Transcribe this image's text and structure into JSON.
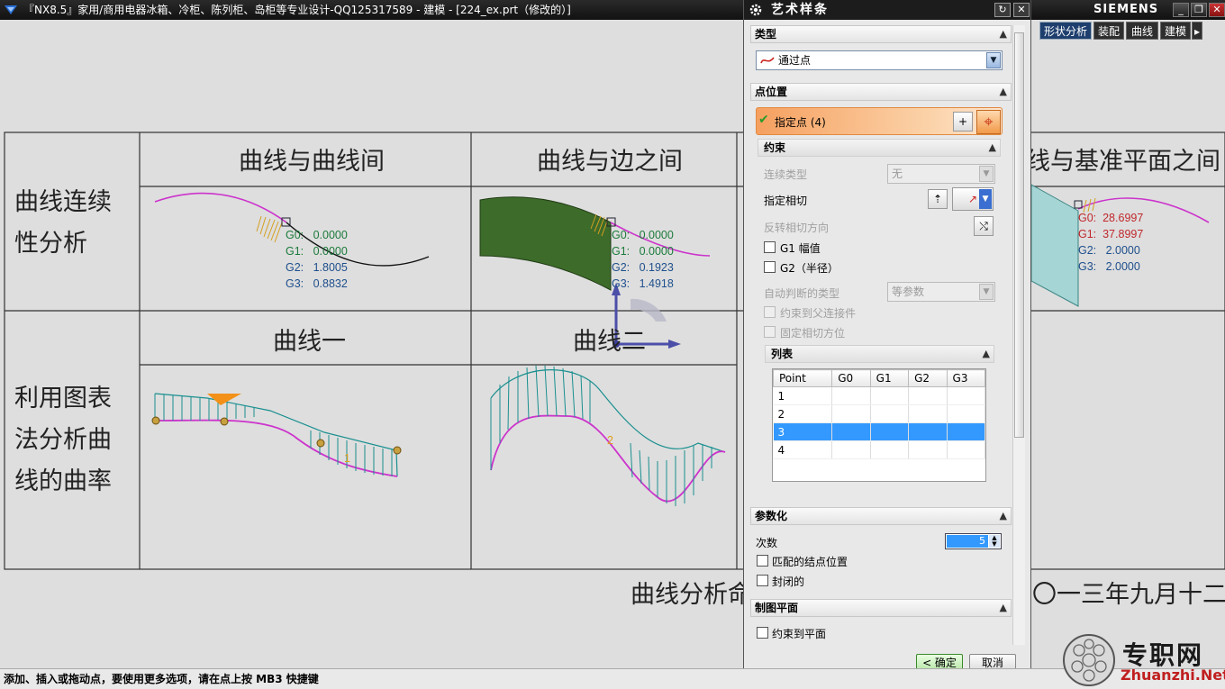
{
  "window": {
    "title": "『NX8.5』家用/商用电器冰箱、冷柜、陈列柜、岛柜等专业设计-QQ125317589 - 建模 - [224_ex.prt（修改的）]",
    "brand": "SIEMENS",
    "controls": {
      "minimize": "_",
      "restore": "❐",
      "close": "✕"
    }
  },
  "app_tabs": [
    "形状分析",
    "装配",
    "曲线",
    "建模",
    "▸"
  ],
  "canvas": {
    "header_row": {
      "col1": "曲线与曲线间",
      "col2": "曲线与边之间",
      "col3": "曲线与基准平面之间"
    },
    "row1_label": "曲线连续性分析",
    "row2_label": "利用图表法分析曲线的曲率",
    "row2_headers": {
      "col1": "曲线一",
      "col2": "曲线二"
    },
    "analysis1": [
      {
        "label": "G0:",
        "value": "0.0000"
      },
      {
        "label": "G1:",
        "value": "0.0000"
      },
      {
        "label": "G2:",
        "value": "1.8005"
      },
      {
        "label": "G3:",
        "value": "0.8832"
      }
    ],
    "analysis2": [
      {
        "label": "G0:",
        "value": "0.0000"
      },
      {
        "label": "G1:",
        "value": "0.0000"
      },
      {
        "label": "G2:",
        "value": "0.1923"
      },
      {
        "label": "G3:",
        "value": "1.4918"
      }
    ],
    "analysis3": [
      {
        "label": "G0:",
        "value": "28.6997"
      },
      {
        "label": "G1:",
        "value": "37.8997"
      },
      {
        "label": "G2:",
        "value": "2.0000"
      },
      {
        "label": "G3:",
        "value": "2.0000"
      }
    ],
    "marker_1": "1",
    "marker_2": "2",
    "footer_left": "曲线分析命",
    "footer_right": "〇一三年九月十二日"
  },
  "dialog": {
    "title": "艺术样条",
    "sections": {
      "type": {
        "label": "类型",
        "value": "通过点"
      },
      "point_position": {
        "label": "点位置",
        "specify_point": "指定点 (4)"
      },
      "constraints": {
        "label": "约束",
        "continuity_type_label": "连续类型",
        "continuity_type_value": "无",
        "specify_tangent": "指定相切",
        "reverse_tangent": "反转相切方向",
        "g1_magnitude": "G1 幅值",
        "g2_radius": "G2（半径）",
        "auto_type_label": "自动判断的类型",
        "auto_type_value": "等参数",
        "constrain_to_parent": "约束到父连接件",
        "fix_tangent": "固定相切方位"
      },
      "list": {
        "label": "列表",
        "columns": [
          "Point",
          "G0",
          "G1",
          "G2",
          "G3"
        ],
        "rows": [
          "1",
          "2",
          "3",
          "4"
        ],
        "selected_row": "3"
      },
      "parameterization": {
        "label": "参数化",
        "degree_label": "次数",
        "degree_value": "5",
        "matched_knots": "匹配的结点位置",
        "closed": "封闭的"
      },
      "drawing_plane": {
        "label": "制图平面",
        "constrain_to_plane": "约束到平面"
      }
    },
    "ok": "< 确定 >",
    "cancel": "取消"
  },
  "status": "添加、插入或拖动点，要使用更多选项，请在点上按 MB3 快捷键",
  "watermark": {
    "main": "专职网",
    "sub": "Zhuanzhi.Net"
  },
  "colors": {
    "magenta_curve": "#cc33cc",
    "teal_comb": "#1a8f8f",
    "g_text_blue": "#1e4f8c",
    "g_text_green": "#1b7a3a",
    "g_text_red": "#c0282c",
    "selection": "#3399ff"
  }
}
